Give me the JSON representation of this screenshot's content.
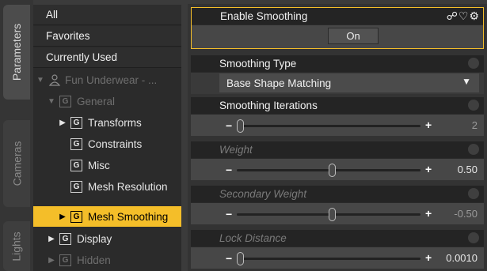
{
  "side_tabs": [
    {
      "label": "Parameters",
      "active": true
    },
    {
      "label": "Cameras",
      "active": false
    },
    {
      "label": "Lights",
      "active": false
    }
  ],
  "tree": {
    "top_items": [
      "All",
      "Favorites",
      "Currently Used"
    ],
    "object_label": "Fun Underwear - ...",
    "group_icon_glyph": "G",
    "nodes": [
      {
        "label": "General",
        "expanded": true,
        "dim": true
      },
      {
        "label": "Transforms",
        "expandable": true
      },
      {
        "label": "Constraints"
      },
      {
        "label": "Misc"
      },
      {
        "label": "Mesh Resolution"
      },
      {
        "label": "Mesh Smoothing",
        "selected": true
      },
      {
        "label": "Display",
        "expandable": true
      },
      {
        "label": "Hidden",
        "expandable": true,
        "dim": true
      }
    ]
  },
  "params": {
    "enable_smoothing": {
      "label": "Enable Smoothing",
      "value": "On"
    },
    "smoothing_type": {
      "label": "Smoothing Type",
      "value": "Base Shape Matching"
    },
    "smoothing_iterations": {
      "label": "Smoothing Iterations",
      "value": "2",
      "fraction": 0.0
    },
    "weight": {
      "label": "Weight",
      "value": "0.50",
      "fraction": 0.5
    },
    "secondary_weight": {
      "label": "Secondary Weight",
      "value": "-0.50",
      "fraction": 0.5
    },
    "lock_distance": {
      "label": "Lock Distance",
      "value": "0.0010",
      "fraction": 0.0
    }
  },
  "colors": {
    "accent": "#f4be29",
    "panel_bg": "#2b2b2b",
    "header_bg": "#242424"
  }
}
